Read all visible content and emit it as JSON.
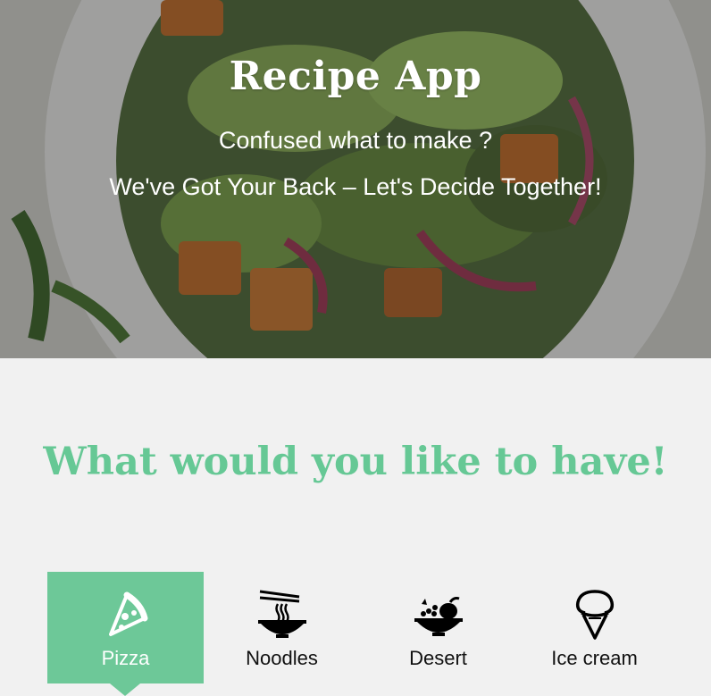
{
  "hero": {
    "title": "Recipe App",
    "line1": "Confused what to make ?",
    "line2": "We've Got Your Back – Let's Decide Together!"
  },
  "section": {
    "heading": "What would you like to have!"
  },
  "categories": [
    {
      "label": "Pizza",
      "icon": "pizza-slice-icon",
      "active": true
    },
    {
      "label": "Noodles",
      "icon": "noodle-bowl-icon",
      "active": false
    },
    {
      "label": "Desert",
      "icon": "fruit-bowl-icon",
      "active": false
    },
    {
      "label": "Ice cream",
      "icon": "ice-cream-cone-icon",
      "active": false
    }
  ],
  "colors": {
    "accent": "#6dc898",
    "heading": "#66c895",
    "background": "#f1f1f1"
  }
}
